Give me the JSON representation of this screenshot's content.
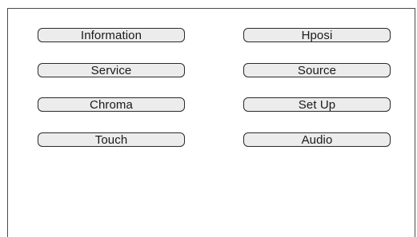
{
  "menu": {
    "left_column": [
      {
        "label": "Information"
      },
      {
        "label": "Service"
      },
      {
        "label": "Chroma"
      },
      {
        "label": "Touch"
      }
    ],
    "right_column": [
      {
        "label": "Hposi"
      },
      {
        "label": "Source"
      },
      {
        "label": "Set Up"
      },
      {
        "label": "Audio"
      }
    ]
  },
  "colors": {
    "button_fill": "#ececec",
    "button_border": "#2a2a2a",
    "panel_border": "#4a4a4a",
    "background": "#ffffff",
    "text": "#1a1a1a"
  }
}
